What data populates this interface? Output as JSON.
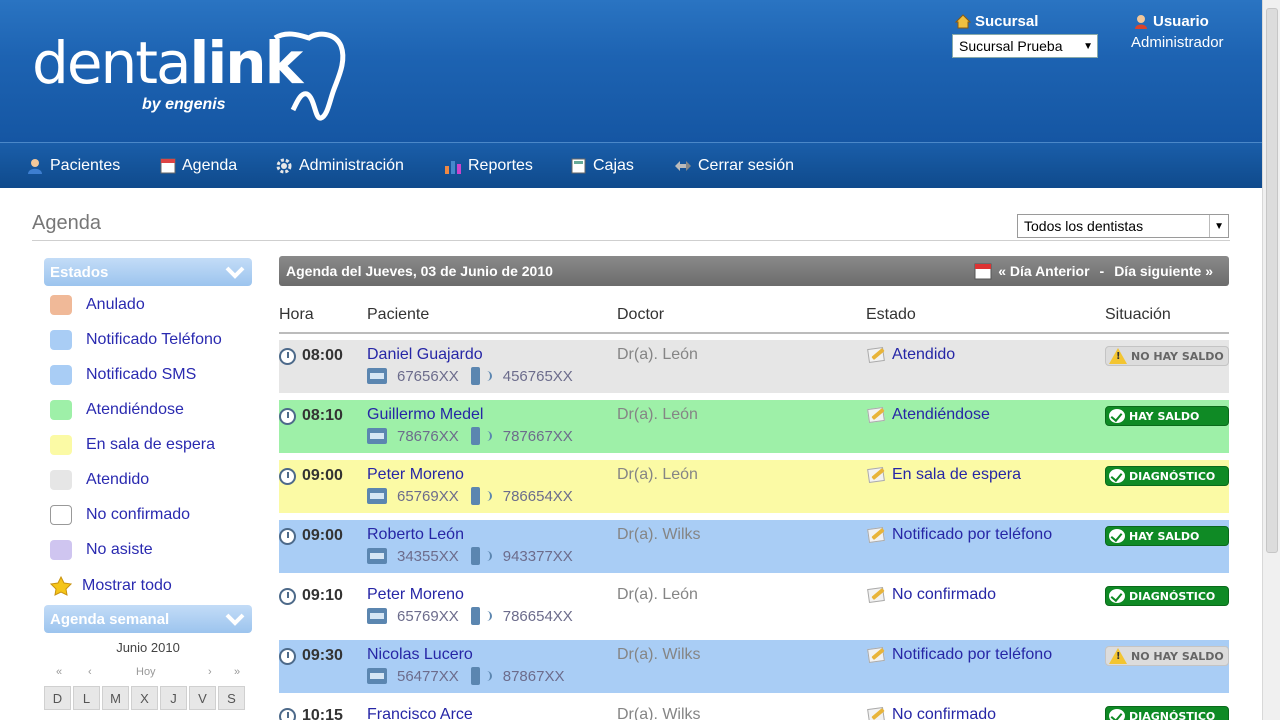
{
  "brand": {
    "name_light": "denta",
    "name_bold": "link",
    "sub": "by engenis"
  },
  "header": {
    "branch_label": "Sucursal",
    "branch_value": "Sucursal Prueba",
    "user_label": "Usuario",
    "user_name": "Administrador"
  },
  "nav": [
    {
      "label": "Pacientes",
      "icon": "patients-icon"
    },
    {
      "label": "Agenda",
      "icon": "calendar-icon"
    },
    {
      "label": "Administración",
      "icon": "gear-icon"
    },
    {
      "label": "Reportes",
      "icon": "bar-chart-icon"
    },
    {
      "label": "Cajas",
      "icon": "cash-register-icon"
    },
    {
      "label": "Cerrar sesión",
      "icon": "logout-icon"
    }
  ],
  "page": {
    "title": "Agenda",
    "dentist_filter": "Todos los dentistas"
  },
  "sidebar": {
    "states_title": "Estados",
    "states": [
      {
        "label": "Anulado",
        "color": "#f0b998"
      },
      {
        "label": "Notificado Teléfono",
        "color": "#a9cdf5"
      },
      {
        "label": "Notificado SMS",
        "color": "#a9cdf5"
      },
      {
        "label": "Atendiéndose",
        "color": "#9ef0a8"
      },
      {
        "label": "En sala de espera",
        "color": "#fbfaa5"
      },
      {
        "label": "Atendido",
        "color": "#e6e6e6"
      },
      {
        "label": "No confirmado",
        "color": "#ffffff"
      },
      {
        "label": "No asiste",
        "color": "#cfc5f0"
      }
    ],
    "show_all": "Mostrar todo",
    "weekly_title": "Agenda semanal",
    "calendar": {
      "month": "Junio 2010",
      "prev_year": "«",
      "prev_month": "‹",
      "today": "Hoy",
      "next_month": "›",
      "next_year": "»",
      "days": [
        "D",
        "L",
        "M",
        "X",
        "J",
        "V",
        "S"
      ]
    }
  },
  "agenda": {
    "title": "Agenda del Jueves, 03 de Junio de 2010",
    "prev": "« Día Anterior",
    "separator": "-",
    "next": "Día siguiente »",
    "columns": {
      "hora": "Hora",
      "paciente": "Paciente",
      "doctor": "Doctor",
      "estado": "Estado",
      "situacion": "Situación"
    },
    "rows": [
      {
        "time": "08:00",
        "patient": "Daniel Guajardo",
        "phone": "67656XX",
        "mobile": "456765XX",
        "doctor": "Dr(a). León",
        "status": "Atendido",
        "situation": "NO HAY SALDO",
        "situation_type": "warn",
        "bg": "#e6e6e6"
      },
      {
        "time": "08:10",
        "patient": "Guillermo Medel",
        "phone": "78676XX",
        "mobile": "787667XX",
        "doctor": "Dr(a). León",
        "status": "Atendiéndose",
        "situation": "HAY SALDO",
        "situation_type": "ok",
        "bg": "#9ef0a8"
      },
      {
        "time": "09:00",
        "patient": "Peter Moreno",
        "phone": "65769XX",
        "mobile": "786654XX",
        "doctor": "Dr(a). León",
        "status": "En sala de espera",
        "situation": "DIAGNÓSTICO",
        "situation_type": "ok",
        "bg": "#fbfaa5"
      },
      {
        "time": "09:00",
        "patient": "Roberto León",
        "phone": "34355XX",
        "mobile": "943377XX",
        "doctor": "Dr(a). Wilks",
        "status": "Notificado por teléfono",
        "situation": "HAY SALDO",
        "situation_type": "ok",
        "bg": "#a9cdf5"
      },
      {
        "time": "09:10",
        "patient": "Peter Moreno",
        "phone": "65769XX",
        "mobile": "786654XX",
        "doctor": "Dr(a). León",
        "status": "No confirmado",
        "situation": "DIAGNÓSTICO",
        "situation_type": "ok",
        "bg": "#ffffff"
      },
      {
        "time": "09:30",
        "patient": "Nicolas Lucero",
        "phone": "56477XX",
        "mobile": "87867XX",
        "doctor": "Dr(a). Wilks",
        "status": "Notificado por teléfono",
        "situation": "NO HAY SALDO",
        "situation_type": "warn",
        "bg": "#a9cdf5"
      },
      {
        "time": "10:15",
        "patient": "Francisco Arce",
        "phone": "",
        "mobile": "",
        "doctor": "Dr(a). Wilks",
        "status": "No confirmado",
        "situation": "DIAGNÓSTICO",
        "situation_type": "ok",
        "bg": "#ffffff"
      }
    ]
  }
}
